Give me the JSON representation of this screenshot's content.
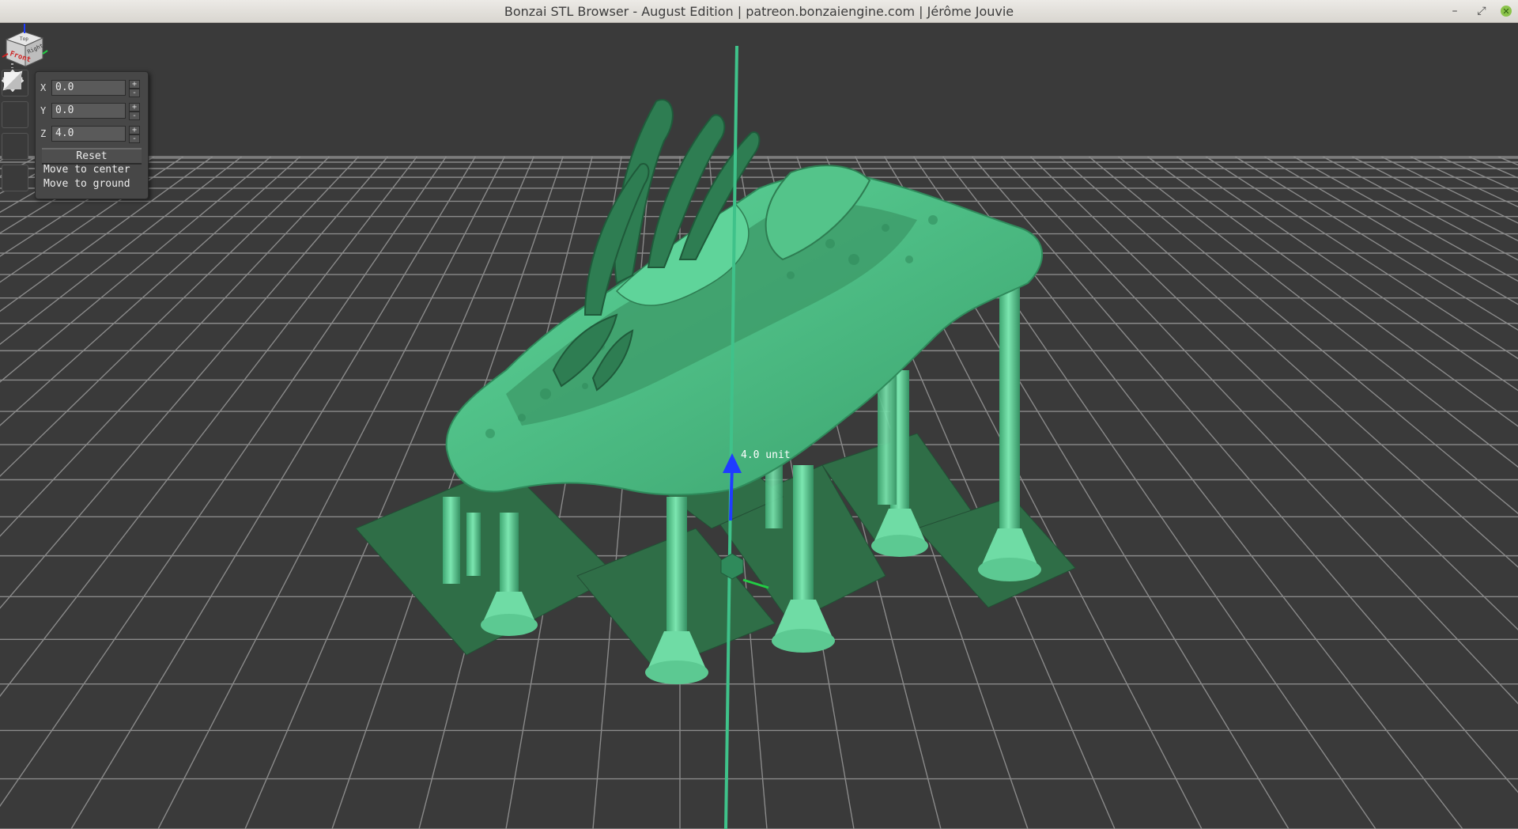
{
  "window": {
    "title": "Bonzai STL Browser - August Edition | patreon.bonzaiengine.com | Jérôme Jouvie",
    "controls": {
      "minimize": "–",
      "restore": "⤢",
      "close": "✕"
    }
  },
  "toolbar": {
    "tools": [
      {
        "name": "move-tool-icon"
      },
      {
        "name": "rotate-tool-icon"
      },
      {
        "name": "scale-tool-icon"
      },
      {
        "name": "plane-tool-icon"
      }
    ]
  },
  "transform_panel": {
    "x_label": "X",
    "x_value": "0.0",
    "y_label": "Y",
    "y_value": "0.0",
    "z_label": "Z",
    "z_value": "4.0",
    "stepper_plus": "+",
    "stepper_minus": "-",
    "reset_label": "Reset",
    "move_center_label": "Move to center",
    "move_ground_label": "Move to ground"
  },
  "gizmo": {
    "label": "4.0 unit"
  },
  "viewcube": {
    "front_label": "Front",
    "right_label": "Right",
    "top_label": "Top"
  },
  "colors": {
    "background": "#3a3a3a",
    "grid": "#8a8a8a",
    "model": "#4fc08a",
    "model_dark": "#2e7d52",
    "base_plate": "#2f6e47",
    "gizmo_z": "#1f3cff",
    "gizmo_x": "#22cc44"
  }
}
